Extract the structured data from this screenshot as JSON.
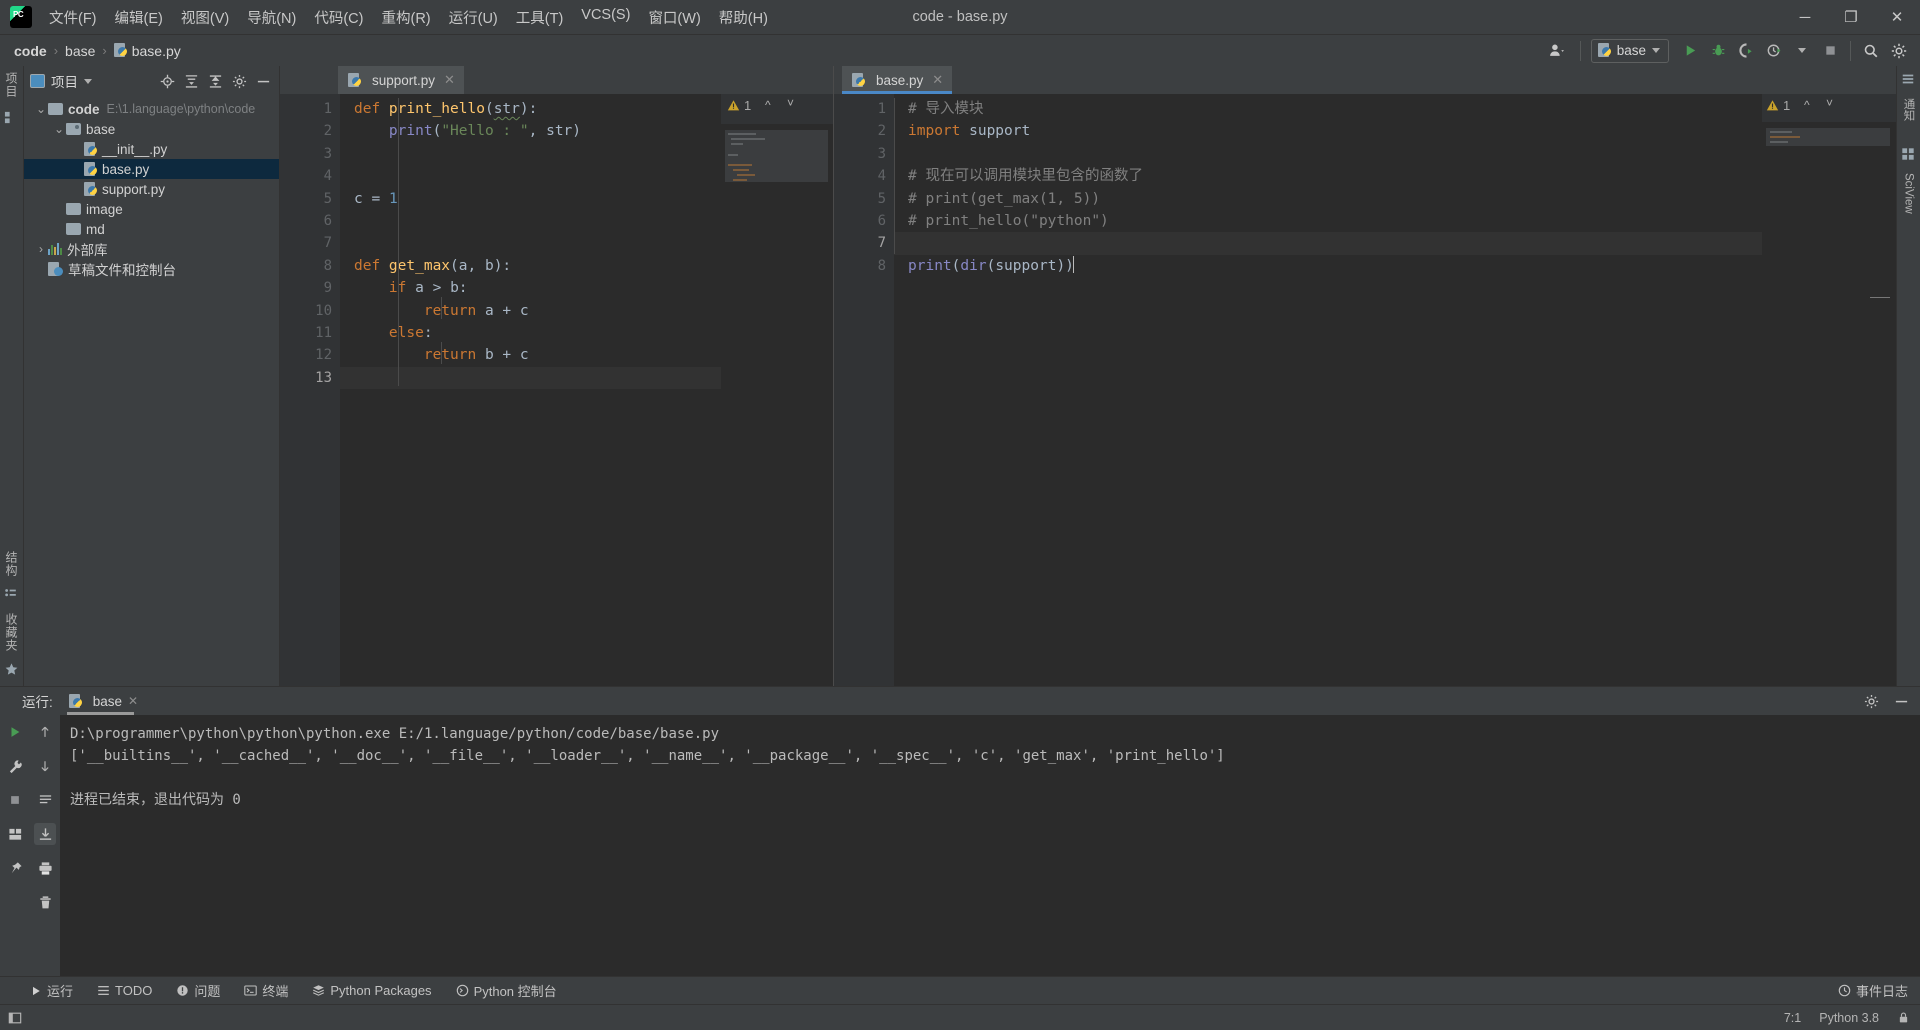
{
  "window": {
    "title": "code - base.py",
    "minimize": "─",
    "maximize": "❐",
    "close": "✕"
  },
  "menubar": {
    "logo": "pycharm-logo",
    "items": [
      {
        "label": "文件(F)"
      },
      {
        "label": "编辑(E)"
      },
      {
        "label": "视图(V)"
      },
      {
        "label": "导航(N)"
      },
      {
        "label": "代码(C)"
      },
      {
        "label": "重构(R)"
      },
      {
        "label": "运行(U)"
      },
      {
        "label": "工具(T)"
      },
      {
        "label": "VCS(S)"
      },
      {
        "label": "窗口(W)"
      },
      {
        "label": "帮助(H)"
      }
    ]
  },
  "navbar": {
    "breadcrumbs": [
      {
        "label": "code",
        "icon": ""
      },
      {
        "label": "base",
        "icon": ""
      },
      {
        "label": "base.py",
        "icon": "python-file-icon"
      }
    ],
    "separator": "›",
    "run_config": "base",
    "buttons": [
      {
        "name": "account-icon",
        "label": ""
      },
      {
        "name": "run-button",
        "label": ""
      },
      {
        "name": "debug-button",
        "label": ""
      },
      {
        "name": "run-coverage-button",
        "label": ""
      },
      {
        "name": "profile-button",
        "label": ""
      },
      {
        "name": "stop-button",
        "label": ""
      },
      {
        "name": "search-everywhere-button",
        "label": ""
      },
      {
        "name": "settings-button",
        "label": ""
      }
    ]
  },
  "left_strip": {
    "project_label": "项目",
    "structure_label": "结构",
    "favorites_label": "收藏夹"
  },
  "right_strip": {
    "notifications_label": "通知",
    "sciview_label": "SciView"
  },
  "project_panel": {
    "title": "项目",
    "actions": [
      "locate-icon",
      "expand-all-icon",
      "collapse-all-icon",
      "settings-icon",
      "hide-icon"
    ],
    "tree": [
      {
        "label": "code",
        "detail": "E:\\1.language\\python\\code",
        "indent": 0,
        "type": "root",
        "arrow": "⌄",
        "selected": false,
        "bold": true
      },
      {
        "label": "base",
        "detail": "",
        "indent": 1,
        "type": "source-folder",
        "arrow": "⌄",
        "selected": false,
        "bold": false
      },
      {
        "label": "__init__.py",
        "detail": "",
        "indent": 2,
        "type": "python-file",
        "arrow": "",
        "selected": false,
        "bold": false
      },
      {
        "label": "base.py",
        "detail": "",
        "indent": 2,
        "type": "python-file",
        "arrow": "",
        "selected": true,
        "bold": false
      },
      {
        "label": "support.py",
        "detail": "",
        "indent": 2,
        "type": "python-file",
        "arrow": "",
        "selected": false,
        "bold": false
      },
      {
        "label": "image",
        "detail": "",
        "indent": 1,
        "type": "folder",
        "arrow": "",
        "selected": false,
        "bold": false
      },
      {
        "label": "md",
        "detail": "",
        "indent": 1,
        "type": "folder",
        "arrow": "",
        "selected": false,
        "bold": false
      },
      {
        "label": "外部库",
        "detail": "",
        "indent": 0,
        "type": "library",
        "arrow": "›",
        "selected": false,
        "bold": false
      },
      {
        "label": "草稿文件和控制台",
        "detail": "",
        "indent": 0,
        "type": "scratch",
        "arrow": "",
        "selected": false,
        "bold": false
      }
    ]
  },
  "editor_left": {
    "tab": {
      "label": "support.py",
      "close": "✕",
      "active": false
    },
    "warning_count": "1",
    "lines": [
      {
        "n": "1",
        "fold": "start",
        "tokens": [
          {
            "t": "def ",
            "c": "k"
          },
          {
            "t": "print_hello",
            "c": "fn"
          },
          {
            "t": "(",
            "c": "txt"
          },
          {
            "t": "str",
            "c": "pa-underline"
          },
          {
            "t": "):",
            "c": "txt"
          }
        ]
      },
      {
        "n": "2",
        "fold": "end",
        "tokens": [
          {
            "t": "    ",
            "c": "txt"
          },
          {
            "t": "print",
            "c": "pr"
          },
          {
            "t": "(",
            "c": "txt"
          },
          {
            "t": "\"Hello : \"",
            "c": "s"
          },
          {
            "t": ", ",
            "c": "txt"
          },
          {
            "t": "str",
            "c": "pa"
          },
          {
            "t": ")",
            "c": "txt"
          }
        ]
      },
      {
        "n": "3",
        "fold": "",
        "tokens": []
      },
      {
        "n": "4",
        "fold": "",
        "tokens": []
      },
      {
        "n": "5",
        "fold": "",
        "tokens": [
          {
            "t": "c ",
            "c": "pa"
          },
          {
            "t": "= ",
            "c": "txt"
          },
          {
            "t": "1",
            "c": "n"
          }
        ]
      },
      {
        "n": "6",
        "fold": "",
        "tokens": []
      },
      {
        "n": "7",
        "fold": "",
        "tokens": []
      },
      {
        "n": "8",
        "fold": "start",
        "tokens": [
          {
            "t": "def ",
            "c": "k"
          },
          {
            "t": "get_max",
            "c": "fn"
          },
          {
            "t": "(",
            "c": "txt"
          },
          {
            "t": "a",
            "c": "pa"
          },
          {
            "t": ", ",
            "c": "txt"
          },
          {
            "t": "b",
            "c": "pa"
          },
          {
            "t": "):",
            "c": "txt"
          }
        ]
      },
      {
        "n": "9",
        "fold": "",
        "tokens": [
          {
            "t": "    ",
            "c": "txt"
          },
          {
            "t": "if ",
            "c": "k"
          },
          {
            "t": "a ",
            "c": "pa"
          },
          {
            "t": "> ",
            "c": "txt"
          },
          {
            "t": "b",
            "c": "pa"
          },
          {
            "t": ":",
            "c": "txt"
          }
        ]
      },
      {
        "n": "10",
        "fold": "",
        "tokens": [
          {
            "t": "        ",
            "c": "txt"
          },
          {
            "t": "return ",
            "c": "k"
          },
          {
            "t": "a ",
            "c": "pa"
          },
          {
            "t": "+ ",
            "c": "txt"
          },
          {
            "t": "c",
            "c": "pa"
          }
        ]
      },
      {
        "n": "11",
        "fold": "",
        "tokens": [
          {
            "t": "    ",
            "c": "txt"
          },
          {
            "t": "else",
            "c": "k"
          },
          {
            "t": ":",
            "c": "txt"
          }
        ]
      },
      {
        "n": "12",
        "fold": "end",
        "tokens": [
          {
            "t": "        ",
            "c": "txt"
          },
          {
            "t": "return ",
            "c": "k"
          },
          {
            "t": "b ",
            "c": "pa"
          },
          {
            "t": "+ ",
            "c": "txt"
          },
          {
            "t": "c",
            "c": "pa"
          }
        ]
      },
      {
        "n": "13",
        "fold": "",
        "tokens": [],
        "current": true
      }
    ]
  },
  "editor_right": {
    "tab": {
      "label": "base.py",
      "close": "✕",
      "active": true
    },
    "warning_count": "1",
    "lines": [
      {
        "n": "1",
        "fold": "",
        "tokens": [
          {
            "t": "# 导入模块",
            "c": "cm"
          }
        ]
      },
      {
        "n": "2",
        "fold": "",
        "tokens": [
          {
            "t": "import ",
            "c": "k"
          },
          {
            "t": "support",
            "c": "txt"
          }
        ]
      },
      {
        "n": "3",
        "fold": "",
        "tokens": []
      },
      {
        "n": "4",
        "fold": "start",
        "tokens": [
          {
            "t": "# 现在可以调用模块里包含的函数了",
            "c": "cm"
          }
        ]
      },
      {
        "n": "5",
        "fold": "",
        "tokens": [
          {
            "t": "# print(get_max(1, 5))",
            "c": "cm"
          }
        ]
      },
      {
        "n": "6",
        "fold": "end",
        "tokens": [
          {
            "t": "# print_hello(\"python\")",
            "c": "cm"
          }
        ]
      },
      {
        "n": "7",
        "fold": "",
        "tokens": [],
        "current": true
      },
      {
        "n": "8",
        "fold": "",
        "tokens": [
          {
            "t": "print",
            "c": "pr"
          },
          {
            "t": "(",
            "c": "txt"
          },
          {
            "t": "dir",
            "c": "bi"
          },
          {
            "t": "(",
            "c": "txt"
          },
          {
            "t": "support",
            "c": "txt"
          },
          {
            "t": "))",
            "c": "txt"
          }
        ],
        "caret": true
      }
    ]
  },
  "run_window": {
    "label": "运行:",
    "tab": "base",
    "tab_close": "✕",
    "settings_icon": "gear-icon",
    "hide_icon": "hide-icon",
    "gutter_buttons": [
      "rerun-icon",
      "up-arrow-icon",
      "wrench-icon",
      "stop-icon",
      "down-arrow-icon",
      "scroll-to-end-icon",
      "layout-icon",
      "print-icon",
      "pin-icon",
      "trash-icon"
    ],
    "console": [
      "D:\\programmer\\python\\python\\python.exe E:/1.language/python/code/base/base.py",
      "['__builtins__', '__cached__', '__doc__', '__file__', '__loader__', '__name__', '__package__', '__spec__', 'c', 'get_max', 'print_hello']",
      "",
      "进程已结束，退出代码为 0"
    ]
  },
  "bottom_bar": {
    "items": [
      {
        "label": "运行",
        "icon": "run-icon"
      },
      {
        "label": "TODO",
        "icon": "todo-icon"
      },
      {
        "label": "问题",
        "icon": "problems-icon"
      },
      {
        "label": "终端",
        "icon": "terminal-icon"
      },
      {
        "label": "Python Packages",
        "icon": "packages-icon"
      },
      {
        "label": "Python 控制台",
        "icon": "python-console-icon"
      }
    ],
    "event_log": "事件日志"
  },
  "status_bar": {
    "caret_position": "7:1",
    "interpreter": "Python 3.8",
    "lock_icon": "lock-icon"
  },
  "colors": {
    "bg_panel": "#3c3f41",
    "bg_editor": "#2b2b2b",
    "bg_gutter": "#313335",
    "selection": "#0d293e",
    "accent": "#4a88c7",
    "keyword": "#cc7832",
    "string": "#6a8759",
    "number": "#6897bb",
    "function": "#ffc66d",
    "comment": "#808080",
    "text": "#a9b7c6",
    "run_green": "#499c54"
  }
}
